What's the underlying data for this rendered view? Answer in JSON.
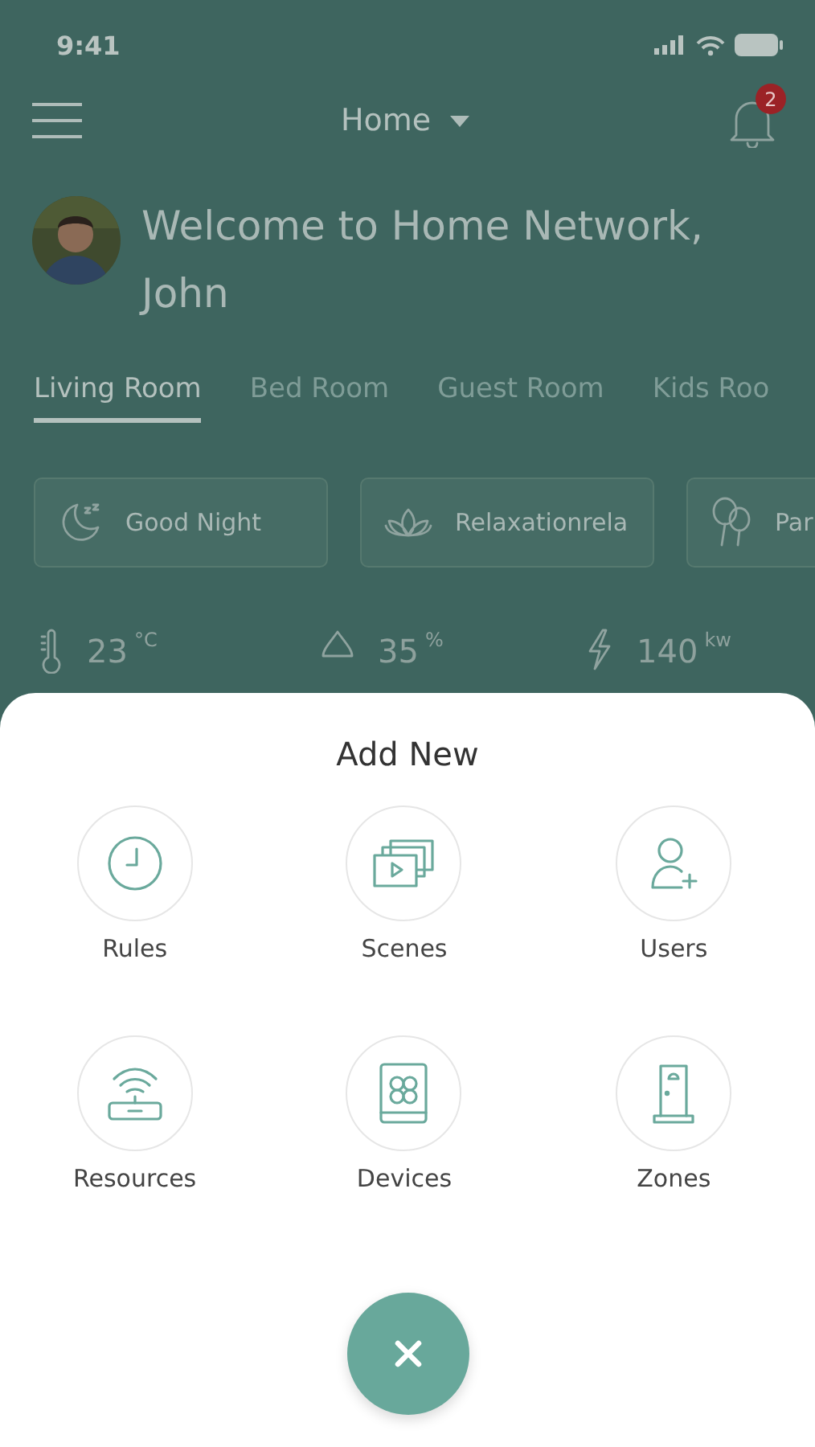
{
  "status_bar": {
    "time": "9:41"
  },
  "header": {
    "title": "Home",
    "notification_count": "2"
  },
  "welcome": {
    "text": "Welcome to Home Network, John"
  },
  "tabs": [
    {
      "label": "Living Room",
      "selected": true
    },
    {
      "label": "Bed Room",
      "selected": false
    },
    {
      "label": "Guest Room",
      "selected": false
    },
    {
      "label": "Kids Roo",
      "selected": false
    }
  ],
  "scenes": [
    {
      "label": "Good Night",
      "kind": "moon"
    },
    {
      "label": "Relaxationrela",
      "kind": "lotus"
    },
    {
      "label": "Par",
      "kind": "balloons"
    }
  ],
  "stats": [
    {
      "kind": "temperature",
      "value": "23",
      "unit": "°C"
    },
    {
      "kind": "humidity",
      "value": "35",
      "unit": "%"
    },
    {
      "kind": "power",
      "value": "140",
      "unit": "kw"
    }
  ],
  "sheet": {
    "title": "Add New",
    "actions": [
      {
        "label": "Rules",
        "kind": "clock"
      },
      {
        "label": "Scenes",
        "kind": "scenes"
      },
      {
        "label": "Users",
        "kind": "user"
      },
      {
        "label": "Resources",
        "kind": "router"
      },
      {
        "label": "Devices",
        "kind": "device"
      },
      {
        "label": "Zones",
        "kind": "door"
      }
    ]
  }
}
